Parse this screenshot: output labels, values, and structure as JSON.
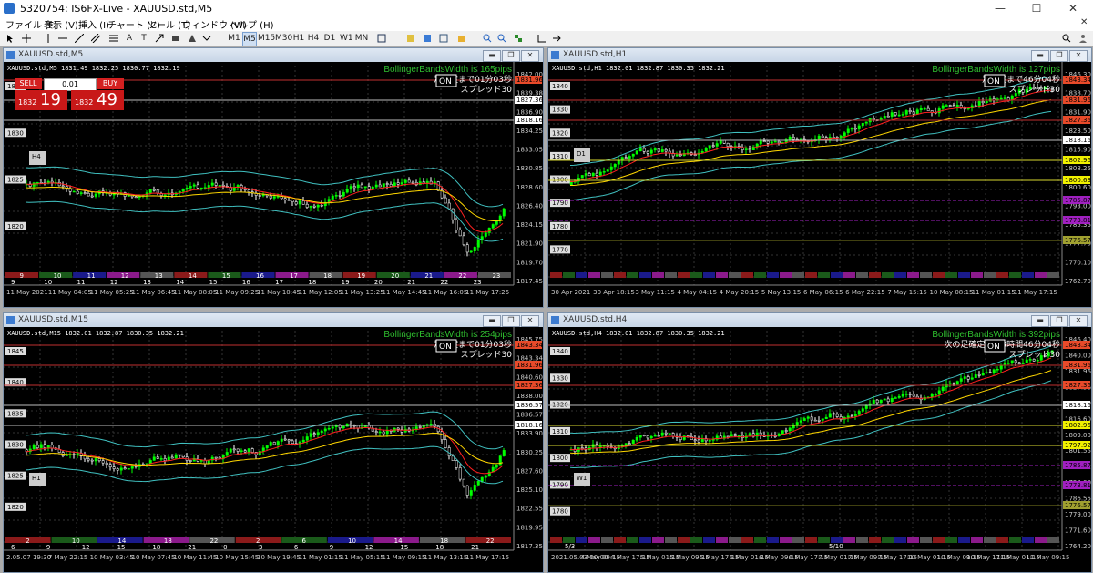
{
  "app": {
    "title": "5320754: IS6FX-Live - XAUUSD.std,M5"
  },
  "menu": [
    "ファイル (F)",
    "表示 (V)",
    "挿入 (I)",
    "チャート (C)",
    "ツール (T)",
    "ウィンドウ (W)",
    "ヘルプ (H)"
  ],
  "toolbar": {
    "timeframes": [
      "M1",
      "M5",
      "M15",
      "M30",
      "H1",
      "H4",
      "D1",
      "W1",
      "MN"
    ],
    "text_tool": "A",
    "text_tool2": "T"
  },
  "windows": [
    {
      "title": "XAUUSD.std,M5",
      "info": "XAUUSD.std,M5  1831.49 1832.25 1830.77 1832.19",
      "bbw": "BollingerBandsWidth is 165pips",
      "jp1": "足確定まで01分03秒",
      "jp2": "スプレッド30",
      "on": "ON",
      "tf_box": "H4",
      "sell": {
        "label": "SELL",
        "big": "19",
        "small": "1832"
      },
      "buy": {
        "label": "BUY",
        "big": "49",
        "small": "1832"
      },
      "lot": "0.01",
      "price_ticks": [
        "1842.00",
        "1839.38",
        "1836.90",
        "1834.25",
        "1833.05",
        "1830.85",
        "1828.60",
        "1826.40",
        "1824.15",
        "1821.90",
        "1819.70",
        "1817.45"
      ],
      "left_ticks": [
        "1835",
        "1830",
        "1825",
        "1820"
      ],
      "red_boxes": [
        "1831.96"
      ],
      "white_boxes": [
        "1827.36",
        "1818.16"
      ],
      "session_labels": [
        "9",
        "10",
        "11",
        "12",
        "13",
        "14",
        "15",
        "16",
        "17",
        "18",
        "19",
        "20",
        "21",
        "22",
        "23"
      ],
      "hour_labels": [
        "9",
        "10",
        "11",
        "12",
        "13",
        "14",
        "15",
        "16",
        "17",
        "18",
        "19",
        "20",
        "21",
        "22",
        "23"
      ],
      "time_labels": [
        "11 May 2021",
        "11 May 04:05",
        "11 May 05:25",
        "11 May 06:45",
        "11 May 08:05",
        "11 May 09:25",
        "11 May 10:45",
        "11 May 12:05",
        "11 May 13:25",
        "11 May 14:45",
        "11 May 16:05",
        "11 May 17:25"
      ]
    },
    {
      "title": "XAUUSD.std,H1",
      "info": "XAUUSD.std,H1  1832.01 1832.87 1830.35 1832.21",
      "bbw": "BollingerBandsWidth is 127pips",
      "jp1": "足確定まで46分04秒",
      "jp2": "スプレッド30",
      "on": "ON",
      "tf_box": "D1",
      "price_ticks": [
        "1846.30",
        "1838.70",
        "1831.90",
        "1823.50",
        "1815.90",
        "1808.25",
        "1800.60",
        "1793.00",
        "1785.35",
        "1777.70",
        "1770.10",
        "1762.70"
      ],
      "left_ticks": [
        "1840",
        "1830",
        "1820",
        "1810",
        "1800",
        "1790",
        "1780",
        "1770"
      ],
      "red_boxes": [
        "1843.34",
        "1831.96",
        "1827.36"
      ],
      "white_boxes": [
        "1818.16"
      ],
      "yellow_boxes": [
        "1802.96",
        "1800.63"
      ],
      "purple_boxes": [
        "1785.87",
        "1773.81"
      ],
      "olive_boxes": [
        "1776.57"
      ],
      "time_labels": [
        "30 Apr 2021",
        "30 Apr 18:15",
        "3 May 11:15",
        "4 May 04:15",
        "4 May 20:15",
        "5 May 13:15",
        "6 May 06:15",
        "6 May 22:15",
        "7 May 15:15",
        "10 May 08:15",
        "11 May 01:15",
        "11 May 17:15"
      ]
    },
    {
      "title": "XAUUSD.std,M15",
      "info": "XAUUSD.std,M15  1832.01 1832.87 1830.35 1832.21",
      "bbw": "BollingerBandsWidth is 254pips",
      "jp1": "足確定まで01分03秒",
      "jp2": "スプレッド30",
      "on": "ON",
      "tf_box": "H1",
      "price_ticks": [
        "1845.75",
        "1843.34",
        "1840.60",
        "1838.00",
        "1836.57",
        "1833.90",
        "1830.25",
        "1827.60",
        "1825.10",
        "1822.55",
        "1819.95",
        "1817.35"
      ],
      "left_ticks": [
        "1845",
        "1840",
        "1835",
        "1830",
        "1825",
        "1820"
      ],
      "red_boxes": [
        "1843.34",
        "1831.96",
        "1827.36"
      ],
      "white_boxes": [
        "1836.57",
        "1818.16"
      ],
      "session_labels": [
        "2",
        "10",
        "14",
        "18",
        "22",
        "2",
        "6",
        "10",
        "14",
        "18",
        "22"
      ],
      "hour_labels": [
        "6",
        "9",
        "12",
        "15",
        "18",
        "21",
        "0",
        "3",
        "6",
        "9",
        "12",
        "15",
        "18",
        "21"
      ],
      "time_labels": [
        "2.05.07 19:30",
        "7 May 22:15",
        "10 May 03:45",
        "10 May 07:45",
        "10 May 11:45",
        "10 May 15:45",
        "10 May 19:45",
        "11 May 01:15",
        "11 May 05:15",
        "11 May 09:15",
        "11 May 13:15",
        "11 May 17:15"
      ]
    },
    {
      "title": "XAUUSD.std,H4",
      "info": "XAUUSD.std,H4  1832.01 1832.87 1830.35 1832.21",
      "bbw": "BollingerBandsWidth is 392pips",
      "jp1": "次の足確定まで3時間46分04秒",
      "jp2": "スプレッド30",
      "on": "ON",
      "tf_box": "W1",
      "price_ticks": [
        "1846.40",
        "1840.00",
        "1831.96",
        "1827.36",
        "1824.00",
        "1816.60",
        "1809.00",
        "1801.55",
        "1797.92",
        "1794.00",
        "1786.55",
        "1779.00",
        "1771.60",
        "1764.20"
      ],
      "left_ticks": [
        "1840",
        "1830",
        "1820",
        "1810",
        "1800",
        "1790",
        "1780"
      ],
      "red_boxes": [
        "1843.34",
        "1831.96",
        "1827.36"
      ],
      "white_boxes": [
        "1818.16"
      ],
      "yellow_boxes": [
        "1802.96",
        "1797.92"
      ],
      "purple_boxes": [
        "1785.87",
        "1773.81"
      ],
      "olive_boxes": [
        "1776.57"
      ],
      "date_markers": [
        "5/3",
        "5/10"
      ],
      "time_labels": [
        "2021.05.03 00:00",
        "4 May 09:15",
        "4 May 17:15",
        "5 May 01:15",
        "5 May 09:15",
        "5 May 17:15",
        "6 May 01:15",
        "6 May 09:15",
        "6 May 17:15",
        "7 May 01:15",
        "7 May 09:15",
        "7 May 17:15",
        "10 May 01:15",
        "10 May 09:15",
        "10 May 17:15",
        "11 May 01:15",
        "11 May 09:15"
      ]
    }
  ],
  "colors": {
    "bull": "#00ff00",
    "bear": "#ffffff",
    "hline_red": "#c03030",
    "hline_white": "#cccccc",
    "ma_red": "#ff2020",
    "ma_yellow": "#ffd700",
    "band_cyan": "#40c0c0"
  }
}
